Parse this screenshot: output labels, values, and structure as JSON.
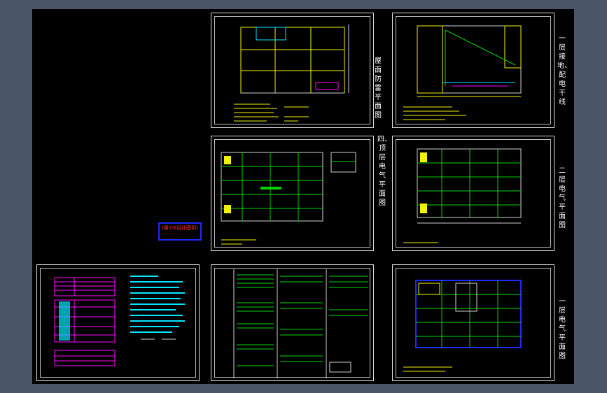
{
  "colors": {
    "background": "#4a5568",
    "canvas": "#000000",
    "frame": "#d8d8d8",
    "yellow": "#f2f200",
    "green": "#00d200",
    "cyan": "#00e5ff",
    "magenta": "#ff00ff",
    "red": "#ff2a2a",
    "blue": "#1c2cff"
  },
  "sheet_labels": {
    "roof": "屋面防雷平面图",
    "top_floor": "四、顶层电气平面图",
    "first_grounding": "一层接地、配电干线",
    "second_floor": "二层电气平面图",
    "first_floor": "一层电气平面图"
  },
  "stamp": {
    "line1": "(第1/6设计图例)",
    "line2": "..................",
    "line3": ".................."
  },
  "icons": {
    "drawing": "cad-drawing-icon"
  }
}
